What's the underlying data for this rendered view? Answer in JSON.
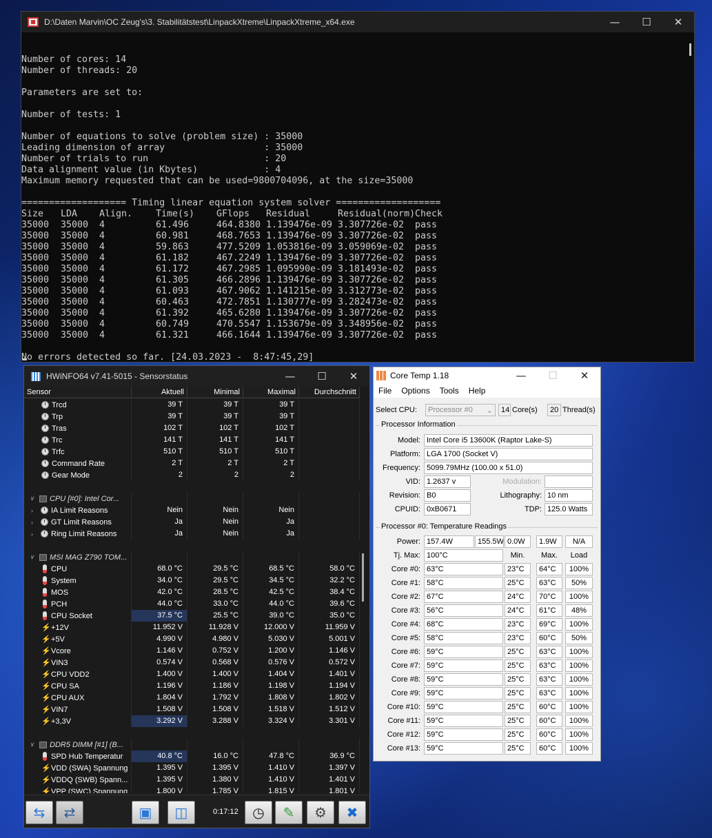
{
  "console": {
    "title": "D:\\Daten Marvin\\OC Zeug's\\3. Stabilitätstest\\LinpackXtreme\\LinpackXtreme_x64.exe",
    "lines": [
      "Number of cores: 14",
      "Number of threads: 20",
      "",
      "Parameters are set to:",
      "",
      "Number of tests: 1",
      "",
      "Number of equations to solve (problem size) : 35000",
      "Leading dimension of array                  : 35000",
      "Number of trials to run                     : 20",
      "Data alignment value (in Kbytes)            : 4",
      "Maximum memory requested that can be used=9800704096, at the size=35000",
      "",
      "=================== Timing linear equation system solver ==================="
    ],
    "headers": [
      "Size",
      "LDA",
      "Align.",
      "Time(s)",
      "GFlops",
      "Residual",
      "Residual(norm)",
      "Check"
    ],
    "rows": [
      [
        "35000",
        "35000",
        "4",
        "61.496",
        "464.8380",
        "1.139476e-09",
        "3.307726e-02",
        "pass"
      ],
      [
        "35000",
        "35000",
        "4",
        "60.981",
        "468.7653",
        "1.139476e-09",
        "3.307726e-02",
        "pass"
      ],
      [
        "35000",
        "35000",
        "4",
        "59.863",
        "477.5209",
        "1.053816e-09",
        "3.059069e-02",
        "pass"
      ],
      [
        "35000",
        "35000",
        "4",
        "61.182",
        "467.2249",
        "1.139476e-09",
        "3.307726e-02",
        "pass"
      ],
      [
        "35000",
        "35000",
        "4",
        "61.172",
        "467.2985",
        "1.095990e-09",
        "3.181493e-02",
        "pass"
      ],
      [
        "35000",
        "35000",
        "4",
        "61.305",
        "466.2896",
        "1.139476e-09",
        "3.307726e-02",
        "pass"
      ],
      [
        "35000",
        "35000",
        "4",
        "61.093",
        "467.9062",
        "1.141215e-09",
        "3.312773e-02",
        "pass"
      ],
      [
        "35000",
        "35000",
        "4",
        "60.463",
        "472.7851",
        "1.130777e-09",
        "3.282473e-02",
        "pass"
      ],
      [
        "35000",
        "35000",
        "4",
        "61.392",
        "465.6280",
        "1.139476e-09",
        "3.307726e-02",
        "pass"
      ],
      [
        "35000",
        "35000",
        "4",
        "60.749",
        "470.5547",
        "1.153679e-09",
        "3.348956e-02",
        "pass"
      ],
      [
        "35000",
        "35000",
        "4",
        "61.321",
        "466.1644",
        "1.139476e-09",
        "3.307726e-02",
        "pass"
      ]
    ],
    "footer": "No errors detected so far. [24.03.2023 -  8:47:45,29]"
  },
  "hwinfo": {
    "title": "HWiNFO64 v7.41-5015 - Sensorstatus",
    "columns": [
      "Sensor",
      "Aktuell",
      "Minimal",
      "Maximal",
      "Durchschnitt"
    ],
    "rows": [
      {
        "t": "clk",
        "n": "Trcd",
        "v": [
          "39 T",
          "39 T",
          "39 T",
          ""
        ]
      },
      {
        "t": "clk",
        "n": "Trp",
        "v": [
          "39 T",
          "39 T",
          "39 T",
          ""
        ]
      },
      {
        "t": "clk",
        "n": "Tras",
        "v": [
          "102 T",
          "102 T",
          "102 T",
          ""
        ]
      },
      {
        "t": "clk",
        "n": "Trc",
        "v": [
          "141 T",
          "141 T",
          "141 T",
          ""
        ]
      },
      {
        "t": "clk",
        "n": "Trfc",
        "v": [
          "510 T",
          "510 T",
          "510 T",
          ""
        ]
      },
      {
        "t": "clk",
        "n": "Command Rate",
        "v": [
          "2 T",
          "2 T",
          "2 T",
          ""
        ]
      },
      {
        "t": "clk",
        "n": "Gear Mode",
        "v": [
          "2",
          "2",
          "2",
          ""
        ]
      },
      {
        "t": "empty"
      },
      {
        "t": "grp",
        "n": "CPU [#0]: Intel Cor..."
      },
      {
        "t": "sub",
        "n": "IA Limit Reasons",
        "v": [
          "Nein",
          "Nein",
          "Nein",
          ""
        ]
      },
      {
        "t": "sub",
        "n": "GT Limit Reasons",
        "v": [
          "Ja",
          "Nein",
          "Ja",
          ""
        ]
      },
      {
        "t": "sub",
        "n": "Ring Limit Reasons",
        "v": [
          "Ja",
          "Nein",
          "Ja",
          ""
        ]
      },
      {
        "t": "empty"
      },
      {
        "t": "grp",
        "n": "MSI MAG Z790 TOM..."
      },
      {
        "t": "thm",
        "n": "CPU",
        "v": [
          "68.0 °C",
          "29.5 °C",
          "68.5 °C",
          "58.0 °C"
        ]
      },
      {
        "t": "thm",
        "n": "System",
        "v": [
          "34.0 °C",
          "29.5 °C",
          "34.5 °C",
          "32.2 °C"
        ]
      },
      {
        "t": "thm",
        "n": "MOS",
        "v": [
          "42.0 °C",
          "28.5 °C",
          "42.5 °C",
          "38.4 °C"
        ]
      },
      {
        "t": "thm",
        "n": "PCH",
        "v": [
          "44.0 °C",
          "33.0 °C",
          "44.0 °C",
          "39.6 °C"
        ]
      },
      {
        "t": "thm",
        "n": "CPU Socket",
        "v": [
          "37.5 °C",
          "25.5 °C",
          "39.0 °C",
          "35.0 °C"
        ],
        "hl": true
      },
      {
        "t": "bolt",
        "n": "+12V",
        "v": [
          "11.952 V",
          "11.928 V",
          "12.000 V",
          "11.959 V"
        ]
      },
      {
        "t": "bolt",
        "n": "+5V",
        "v": [
          "4.990 V",
          "4.980 V",
          "5.030 V",
          "5.001 V"
        ]
      },
      {
        "t": "bolt",
        "n": "Vcore",
        "v": [
          "1.146 V",
          "0.752 V",
          "1.200 V",
          "1.146 V"
        ]
      },
      {
        "t": "bolt",
        "n": "VIN3",
        "v": [
          "0.574 V",
          "0.568 V",
          "0.576 V",
          "0.572 V"
        ]
      },
      {
        "t": "bolt",
        "n": "CPU VDD2",
        "v": [
          "1.400 V",
          "1.400 V",
          "1.404 V",
          "1.401 V"
        ]
      },
      {
        "t": "bolt",
        "n": "CPU SA",
        "v": [
          "1.196 V",
          "1.186 V",
          "1.198 V",
          "1.194 V"
        ]
      },
      {
        "t": "bolt",
        "n": "CPU AUX",
        "v": [
          "1.804 V",
          "1.792 V",
          "1.808 V",
          "1.802 V"
        ]
      },
      {
        "t": "bolt",
        "n": "VIN7",
        "v": [
          "1.508 V",
          "1.508 V",
          "1.518 V",
          "1.512 V"
        ]
      },
      {
        "t": "bolt",
        "n": "+3,3V",
        "v": [
          "3.292 V",
          "3.288 V",
          "3.324 V",
          "3.301 V"
        ],
        "hl": true
      },
      {
        "t": "empty"
      },
      {
        "t": "grp",
        "n": "DDR5 DIMM [#1] (B..."
      },
      {
        "t": "thm",
        "n": "SPD Hub Temperatur",
        "v": [
          "40.8 °C",
          "16.0 °C",
          "47.8 °C",
          "36.9 °C"
        ],
        "hl": true
      },
      {
        "t": "bolt",
        "n": "VDD (SWA) Spannung",
        "v": [
          "1.395 V",
          "1.395 V",
          "1.410 V",
          "1.397 V"
        ]
      },
      {
        "t": "bolt",
        "n": "VDDQ (SWB) Spann...",
        "v": [
          "1.395 V",
          "1.380 V",
          "1.410 V",
          "1.401 V"
        ]
      },
      {
        "t": "bolt",
        "n": "VPP (SWC) Spannung",
        "v": [
          "1.800 V",
          "1.785 V",
          "1.815 V",
          "1.801 V"
        ]
      }
    ],
    "timer": "0:17:12"
  },
  "coretemp": {
    "title": "Core Temp 1.18",
    "menu": [
      "File",
      "Options",
      "Tools",
      "Help"
    ],
    "select_cpu_label": "Select CPU:",
    "select_cpu_value": "Processor #0",
    "cores_value": "14",
    "cores_label": "Core(s)",
    "threads_value": "20",
    "threads_label": "Thread(s)",
    "proc_info_title": "Processor Information",
    "model_label": "Model:",
    "model": "Intel Core i5 13600K (Raptor Lake-S)",
    "platform_label": "Platform:",
    "platform": "LGA 1700 (Socket V)",
    "frequency_label": "Frequency:",
    "frequency": "5099.79MHz (100.00 x 51.0)",
    "vid_label": "VID:",
    "vid": "1.2637 v",
    "modulation_label": "Modulation:",
    "revision_label": "Revision:",
    "revision": "B0",
    "lithography_label": "Lithography:",
    "lithography": "10 nm",
    "cpuid_label": "CPUID:",
    "cpuid": "0xB0671",
    "tdp_label": "TDP:",
    "tdp": "125.0 Watts",
    "temp_title": "Processor #0: Temperature Readings",
    "power_label": "Power:",
    "power": [
      "157.4W",
      "155.5W",
      "0.0W",
      "1.9W",
      "N/A"
    ],
    "tjmax_label": "Tj. Max:",
    "tjmax": "100°C",
    "col_min": "Min.",
    "col_max": "Max.",
    "col_load": "Load",
    "cores": [
      [
        "Core #0:",
        "63°C",
        "23°C",
        "64°C",
        "100%"
      ],
      [
        "Core #1:",
        "58°C",
        "25°C",
        "63°C",
        "50%"
      ],
      [
        "Core #2:",
        "67°C",
        "24°C",
        "70°C",
        "100%"
      ],
      [
        "Core #3:",
        "56°C",
        "24°C",
        "61°C",
        "48%"
      ],
      [
        "Core #4:",
        "68°C",
        "23°C",
        "69°C",
        "100%"
      ],
      [
        "Core #5:",
        "58°C",
        "23°C",
        "60°C",
        "50%"
      ],
      [
        "Core #6:",
        "59°C",
        "25°C",
        "63°C",
        "100%"
      ],
      [
        "Core #7:",
        "59°C",
        "25°C",
        "63°C",
        "100%"
      ],
      [
        "Core #8:",
        "59°C",
        "25°C",
        "63°C",
        "100%"
      ],
      [
        "Core #9:",
        "59°C",
        "25°C",
        "63°C",
        "100%"
      ],
      [
        "Core #10:",
        "59°C",
        "25°C",
        "60°C",
        "100%"
      ],
      [
        "Core #11:",
        "59°C",
        "25°C",
        "60°C",
        "100%"
      ],
      [
        "Core #12:",
        "59°C",
        "25°C",
        "60°C",
        "100%"
      ],
      [
        "Core #13:",
        "59°C",
        "25°C",
        "60°C",
        "100%"
      ]
    ]
  }
}
